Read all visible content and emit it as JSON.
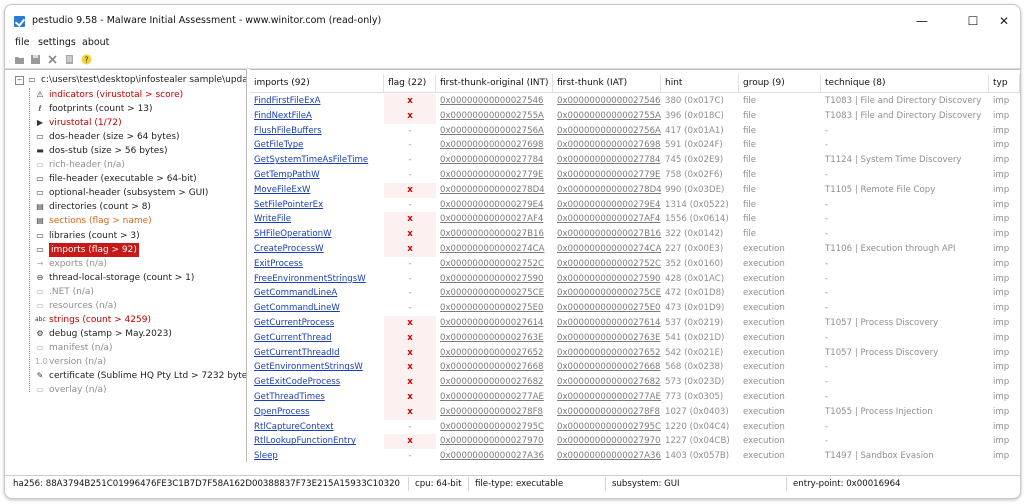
{
  "window": {
    "title": "pestudio 9.58 - Malware Initial Assessment - www.winitor.com (read-only)",
    "minimize": "—",
    "maximize": "☐",
    "close": "✕"
  },
  "menu": [
    "file",
    "settings",
    "about"
  ],
  "toolbar_icons": [
    "open-icon",
    "save-icon",
    "close-file-icon",
    "pages-icon",
    "help-icon"
  ],
  "tree": {
    "root": "c:\\users\\test\\desktop\\infostealer sample\\update_",
    "items": [
      {
        "label": "indicators (virustotal > score)",
        "style": "red",
        "icon": "⚠"
      },
      {
        "label": "footprints (count > 13)",
        "style": "normal",
        "icon": "ℓ"
      },
      {
        "label": "virustotal (1/72)",
        "style": "red",
        "icon": "▶"
      },
      {
        "label": "dos-header (size > 64 bytes)",
        "style": "normal",
        "icon": "▭"
      },
      {
        "label": "dos-stub (size > 56 bytes)",
        "style": "normal",
        "icon": "▬"
      },
      {
        "label": "rich-header (n/a)",
        "style": "gray",
        "icon": "▭"
      },
      {
        "label": "file-header (executable > 64-bit)",
        "style": "normal",
        "icon": "▭"
      },
      {
        "label": "optional-header (subsystem > GUI)",
        "style": "normal",
        "icon": "▭"
      },
      {
        "label": "directories (count > 8)",
        "style": "normal",
        "icon": "▤"
      },
      {
        "label": "sections (flag > name)",
        "style": "orange",
        "icon": "▤"
      },
      {
        "label": "libraries (count > 3)",
        "style": "normal",
        "icon": "▭"
      },
      {
        "label": "imports (flag > 92)",
        "style": "selected",
        "icon": "▭"
      },
      {
        "label": "exports (n/a)",
        "style": "gray",
        "icon": "→"
      },
      {
        "label": "thread-local-storage (count > 1)",
        "style": "normal",
        "icon": "⊖"
      },
      {
        "label": ".NET (n/a)",
        "style": "gray",
        "icon": "▭"
      },
      {
        "label": "resources (n/a)",
        "style": "gray",
        "icon": "▭"
      },
      {
        "label": "strings (count > 4259)",
        "style": "red",
        "icon": "abc"
      },
      {
        "label": "debug (stamp > May.2023)",
        "style": "normal",
        "icon": "⚙"
      },
      {
        "label": "manifest (n/a)",
        "style": "gray",
        "icon": "▭"
      },
      {
        "label": "version (n/a)",
        "style": "gray",
        "icon": "1.0"
      },
      {
        "label": "certificate (Sublime HQ Pty Ltd > 7232 bytes)",
        "style": "normal",
        "icon": "✎"
      },
      {
        "label": "overlay (n/a)",
        "style": "gray",
        "icon": "▭"
      }
    ]
  },
  "table": {
    "columns": [
      "imports (92)",
      "flag (22)",
      "first-thunk-original (INT)",
      "first-thunk (IAT)",
      "hint",
      "group (9)",
      "technique (8)",
      "typ"
    ],
    "rows": [
      {
        "name": "FindFirstFileExA",
        "flag": "x",
        "int": "0x00000000000027546",
        "iat": "0x00000000000027546",
        "hint": "380 (0x017C)",
        "group": "file",
        "technique": "T1083 | File and Directory Discovery",
        "type": "imp"
      },
      {
        "name": "FindNextFileA",
        "flag": "x",
        "int": "0x0000000000002755A",
        "iat": "0x0000000000002755A",
        "hint": "396 (0x018C)",
        "group": "file",
        "technique": "T1083 | File and Directory Discovery",
        "type": "imp"
      },
      {
        "name": "FlushFileBuffers",
        "flag": "-",
        "int": "0x0000000000002756A",
        "iat": "0x0000000000002756A",
        "hint": "417 (0x01A1)",
        "group": "file",
        "technique": "-",
        "type": "imp"
      },
      {
        "name": "GetFileType",
        "flag": "-",
        "int": "0x00000000000027698",
        "iat": "0x00000000000027698",
        "hint": "591 (0x024F)",
        "group": "file",
        "technique": "-",
        "type": "imp"
      },
      {
        "name": "GetSystemTimeAsFileTime",
        "flag": "-",
        "int": "0x00000000000027784",
        "iat": "0x00000000000027784",
        "hint": "745 (0x02E9)",
        "group": "file",
        "technique": "T1124 | System Time Discovery",
        "type": "imp"
      },
      {
        "name": "GetTempPathW",
        "flag": "-",
        "int": "0x0000000000002779E",
        "iat": "0x0000000000002779E",
        "hint": "758 (0x02F6)",
        "group": "file",
        "technique": "-",
        "type": "imp"
      },
      {
        "name": "MoveFileExW",
        "flag": "x",
        "int": "0x000000000000278D4",
        "iat": "0x000000000000278D4",
        "hint": "990 (0x03DE)",
        "group": "file",
        "technique": "T1105 | Remote File Copy",
        "type": "imp"
      },
      {
        "name": "SetFilePointerEx",
        "flag": "-",
        "int": "0x000000000000279E4",
        "iat": "0x000000000000279E4",
        "hint": "1314 (0x0522)",
        "group": "file",
        "technique": "-",
        "type": "imp"
      },
      {
        "name": "WriteFile",
        "flag": "x",
        "int": "0x00000000000027AF4",
        "iat": "0x00000000000027AF4",
        "hint": "1556 (0x0614)",
        "group": "file",
        "technique": "-",
        "type": "imp"
      },
      {
        "name": "SHFileOperationW",
        "flag": "x",
        "int": "0x00000000000027B16",
        "iat": "0x00000000000027B16",
        "hint": "322 (0x0142)",
        "group": "file",
        "technique": "-",
        "type": "imp"
      },
      {
        "name": "CreateProcessW",
        "flag": "x",
        "int": "0x000000000000274CA",
        "iat": "0x000000000000274CA",
        "hint": "227 (0x00E3)",
        "group": "execution",
        "technique": "T1106 | Execution through API",
        "type": "imp"
      },
      {
        "name": "ExitProcess",
        "flag": "-",
        "int": "0x0000000000002752C",
        "iat": "0x0000000000002752C",
        "hint": "352 (0x0160)",
        "group": "execution",
        "technique": "-",
        "type": "imp"
      },
      {
        "name": "FreeEnvironmentStringsW",
        "flag": "-",
        "int": "0x00000000000027590",
        "iat": "0x00000000000027590",
        "hint": "428 (0x01AC)",
        "group": "execution",
        "technique": "-",
        "type": "imp"
      },
      {
        "name": "GetCommandLineA",
        "flag": "-",
        "int": "0x000000000000275CE",
        "iat": "0x000000000000275CE",
        "hint": "472 (0x01D8)",
        "group": "execution",
        "technique": "-",
        "type": "imp"
      },
      {
        "name": "GetCommandLineW",
        "flag": "-",
        "int": "0x000000000000275E0",
        "iat": "0x000000000000275E0",
        "hint": "473 (0x01D9)",
        "group": "execution",
        "technique": "-",
        "type": "imp"
      },
      {
        "name": "GetCurrentProcess",
        "flag": "x",
        "int": "0x00000000000027614",
        "iat": "0x00000000000027614",
        "hint": "537 (0x0219)",
        "group": "execution",
        "technique": "T1057 | Process Discovery",
        "type": "imp"
      },
      {
        "name": "GetCurrentThread",
        "flag": "x",
        "int": "0x0000000000002763E",
        "iat": "0x0000000000002763E",
        "hint": "541 (0x021D)",
        "group": "execution",
        "technique": "-",
        "type": "imp"
      },
      {
        "name": "GetCurrentThreadId",
        "flag": "x",
        "int": "0x00000000000027652",
        "iat": "0x00000000000027652",
        "hint": "542 (0x021E)",
        "group": "execution",
        "technique": "T1057 | Process Discovery",
        "type": "imp"
      },
      {
        "name": "GetEnvironmentStringsW",
        "flag": "x",
        "int": "0x00000000000027668",
        "iat": "0x00000000000027668",
        "hint": "568 (0x0238)",
        "group": "execution",
        "technique": "-",
        "type": "imp"
      },
      {
        "name": "GetExitCodeProcess",
        "flag": "x",
        "int": "0x00000000000027682",
        "iat": "0x00000000000027682",
        "hint": "573 (0x023D)",
        "group": "execution",
        "technique": "-",
        "type": "imp"
      },
      {
        "name": "GetThreadTimes",
        "flag": "x",
        "int": "0x000000000000277AE",
        "iat": "0x000000000000277AE",
        "hint": "773 (0x0305)",
        "group": "execution",
        "technique": "-",
        "type": "imp"
      },
      {
        "name": "OpenProcess",
        "flag": "x",
        "int": "0x000000000000278F8",
        "iat": "0x000000000000278F8",
        "hint": "1027 (0x0403)",
        "group": "execution",
        "technique": "T1055 | Process Injection",
        "type": "imp"
      },
      {
        "name": "RtlCaptureContext",
        "flag": "-",
        "int": "0x0000000000002795C",
        "iat": "0x0000000000002795C",
        "hint": "1220 (0x04C4)",
        "group": "execution",
        "technique": "-",
        "type": "imp"
      },
      {
        "name": "RtlLookupFunctionEntry",
        "flag": "x",
        "int": "0x00000000000027970",
        "iat": "0x00000000000027970",
        "hint": "1227 (0x04CB)",
        "group": "execution",
        "technique": "-",
        "type": "imp"
      },
      {
        "name": "Sleep",
        "flag": "-",
        "int": "0x00000000000027A36",
        "iat": "0x00000000000027A36",
        "hint": "1403 (0x057B)",
        "group": "execution",
        "technique": "T1497 | Sandbox Evasion",
        "type": "imp"
      }
    ]
  },
  "status": {
    "sha256": "ha256: 88A3794B251C01996476FE3C1B7D7F58A162D00388837F73E215A15933C10320",
    "cpu": "cpu: 64-bit",
    "file_type": "file-type: executable",
    "subsystem": "subsystem: GUI",
    "entry_point": "entry-point: 0x00016964"
  }
}
